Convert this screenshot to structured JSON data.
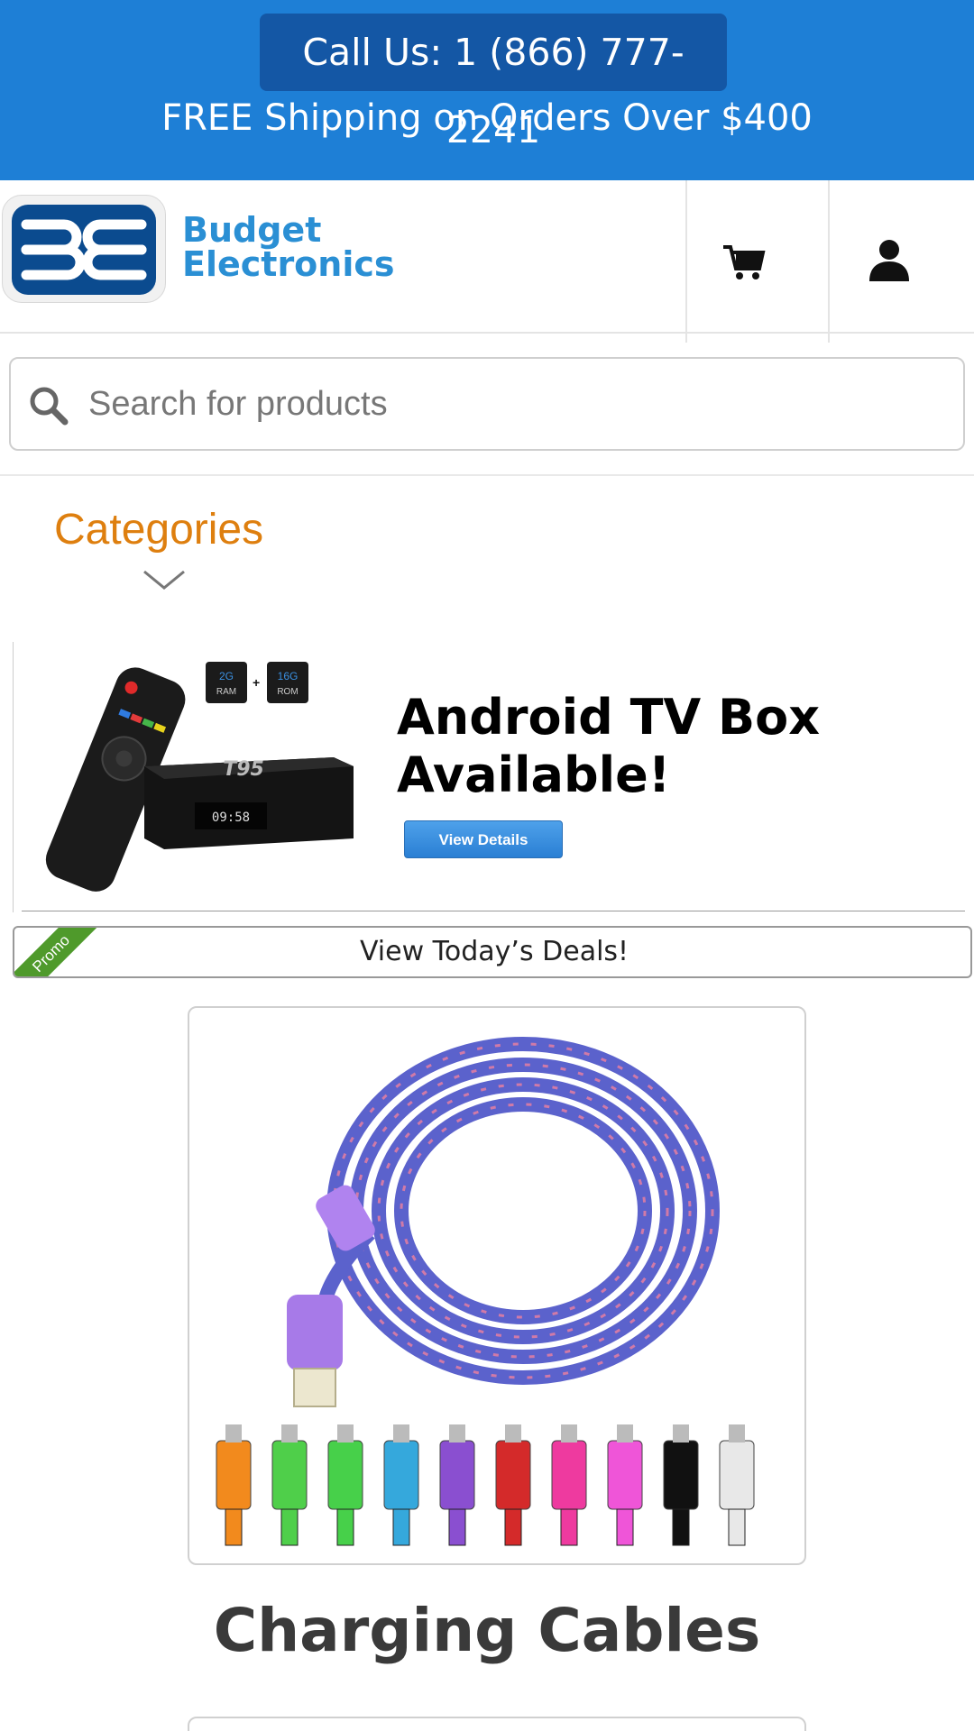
{
  "header_banner": {
    "call_label": "Call Us: 1 (866) 777-2241",
    "shipping_text": "FREE Shipping on Orders Over $400"
  },
  "brand": {
    "line1": "Budget",
    "line2": "Electronics",
    "logo_color": "#0b4b8f",
    "brand_color": "#2a8fd4"
  },
  "header_icons": [
    "cart-icon",
    "user-icon"
  ],
  "search": {
    "placeholder": "Search for products"
  },
  "categories": {
    "label": "Categories"
  },
  "promo_banner": {
    "title_line1": "Android TV Box",
    "title_line2": "Available!",
    "button_label": "View Details",
    "chip1_top": "2G",
    "chip1_bottom": "RAM",
    "chip2_top": "16G",
    "chip2_bottom": "ROM",
    "device_brand": "T95",
    "display_time": "09:58"
  },
  "deals": {
    "label": "View Today’s Deals!",
    "ribbon": "Promo"
  },
  "product": {
    "title": "Charging Cables",
    "cable_colors": [
      "#f28a1d",
      "#4fcf4a",
      "#47d04a",
      "#35a8dc",
      "#8a4fd0",
      "#d42a2a",
      "#ee3a9f",
      "#ef55d8",
      "#111111",
      "#e8e8e8"
    ]
  },
  "colors": {
    "banner_bg": "#1e7fd6",
    "call_btn_bg": "#1457a5",
    "categories": "#de7f0f"
  }
}
